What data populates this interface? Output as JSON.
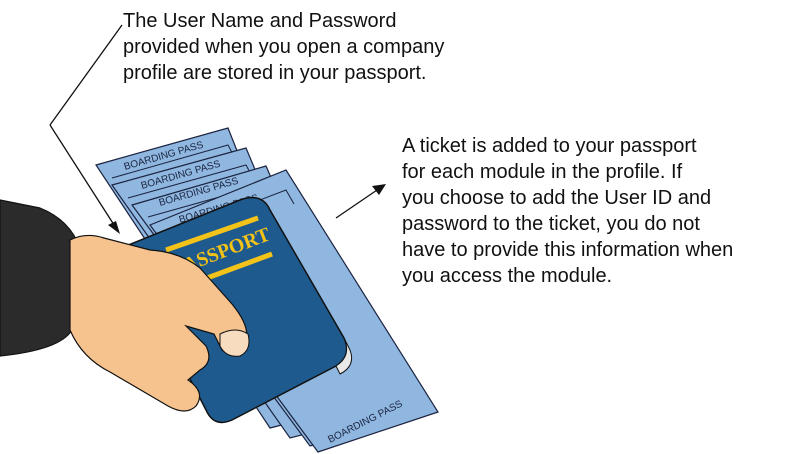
{
  "callouts": {
    "top_lines": [
      "The User Name and Password",
      "provided when you open a company",
      "profile are stored in your passport."
    ],
    "right_lines": [
      "A ticket is added to your passport",
      "for each module in the profile. If",
      "you choose to add the User ID and",
      "password to the ticket, you do not",
      "have to provide this information when",
      "you access the module."
    ]
  },
  "illustration": {
    "boarding_pass_label": "BOARDING PASS",
    "passport_label": "PASSPORT",
    "colors": {
      "boarding_pass": "#8fb7df",
      "passport": "#1e5a8e",
      "passport_band": "#f3c319",
      "skin": "#f6c38f",
      "sleeve": "#2b2b2b"
    }
  }
}
